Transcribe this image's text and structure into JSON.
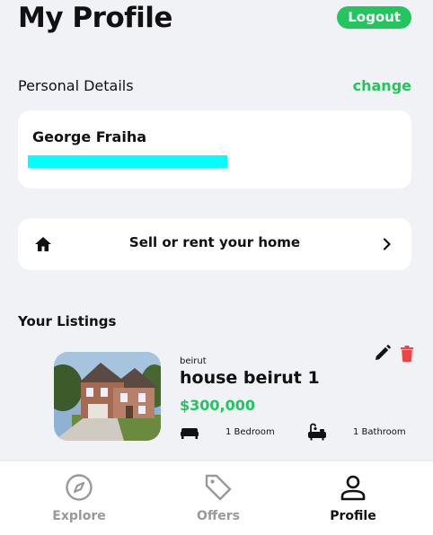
{
  "header": {
    "title": "My Profile",
    "logout_label": "Logout"
  },
  "personal": {
    "label": "Personal Details",
    "change_label": "change",
    "name": "George Fraiha"
  },
  "sell": {
    "label": "Sell or rent your home"
  },
  "listings": {
    "title": "Your Listings",
    "items": [
      {
        "location": "beirut",
        "title": "house beirut 1",
        "price": "$300,000",
        "bedrooms": "1 Bedroom",
        "bathrooms": "1 Bathroom"
      }
    ]
  },
  "nav": {
    "items": [
      {
        "label": "Explore",
        "icon": "compass-icon",
        "active": false
      },
      {
        "label": "Offers",
        "icon": "tag-icon",
        "active": false
      },
      {
        "label": "Profile",
        "icon": "person-icon",
        "active": true
      }
    ]
  },
  "colors": {
    "accent": "#22c55e",
    "delete": "#ef4444",
    "redaction": "#00ffff",
    "background": "#f1f2f6"
  }
}
